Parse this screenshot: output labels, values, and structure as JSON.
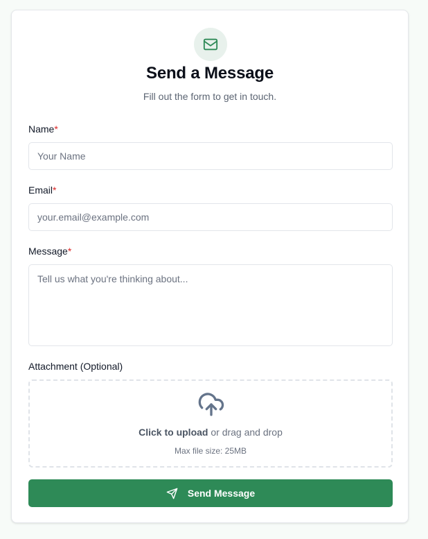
{
  "form": {
    "title": "Send a Message",
    "subtitle": "Fill out the form to get in touch.",
    "header_icon": "mail-icon",
    "accent_color": "#2e8a57",
    "required_marker": "*",
    "fields": {
      "name": {
        "label": "Name",
        "placeholder": "Your Name",
        "value": ""
      },
      "email": {
        "label": "Email",
        "placeholder": "your.email@example.com",
        "value": ""
      },
      "message": {
        "label": "Message",
        "placeholder": "Tell us what you're thinking about...",
        "value": ""
      }
    },
    "attachment": {
      "label": "Attachment (Optional)",
      "icon": "cloud-upload-icon",
      "click_text": "Click to upload",
      "drag_text": " or drag and drop",
      "hint": "Max file size: 25MB"
    },
    "submit": {
      "label": "Send Message",
      "icon": "send-icon"
    }
  }
}
